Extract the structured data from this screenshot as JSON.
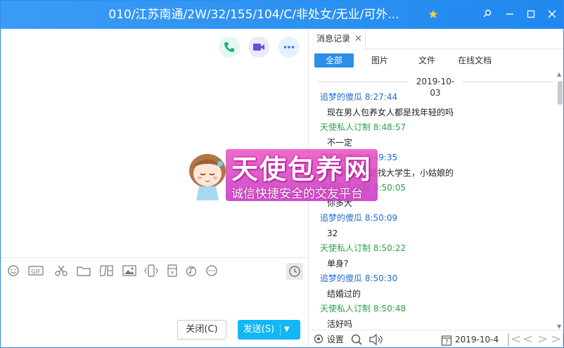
{
  "window": {
    "title": "010/江苏南通/2W/32/155/104/C/非处女/无业/可外...",
    "controls": {
      "pin": "⚲",
      "minimize": "—",
      "maximize": "☐",
      "close": "✕"
    }
  },
  "chat": {
    "actions": {
      "voice_call": "phone-icon",
      "video_call": "video-icon",
      "more": "more-icon"
    },
    "toolbar": {
      "icons": [
        "emoji-icon",
        "gif-icon",
        "scissors-icon",
        "folder-icon",
        "rich-text-icon",
        "image-icon",
        "shake-icon",
        "red-packet-icon",
        "music-icon",
        "more-icon"
      ],
      "gif_label": "GIF",
      "history_icon": "clock-icon"
    },
    "buttons": {
      "close_label": "关闭(C)",
      "send_label": "发送(S)"
    }
  },
  "ad": {
    "title": "天使包养网",
    "subtitle": "诚信快捷安全的交友平台"
  },
  "history": {
    "tab_label": "消息记录",
    "filters": [
      "全部",
      "图片",
      "文件",
      "在线文档"
    ],
    "date": "2019-10-03",
    "messages": [
      {
        "sender": "追梦的傻瓜",
        "time": "8:27:44",
        "text": "现在男人包养女人都是找年轻的吗",
        "color": "#1f6bd0"
      },
      {
        "sender": "天使私人订制",
        "time": "8:48:57",
        "text": "不一定",
        "color": "#2da14a"
      },
      {
        "sender": "追梦的傻瓜",
        "time": "8:49:35",
        "text": "我看你们都是找大学生，小姑娘的",
        "color": "#1f6bd0"
      },
      {
        "sender": "天使私人订制",
        "time": "8:50:05",
        "text": "你多大",
        "color": "#2da14a"
      },
      {
        "sender": "追梦的傻瓜",
        "time": "8:50:09",
        "text": "32",
        "color": "#1f6bd0"
      },
      {
        "sender": "天使私人订制",
        "time": "8:50:22",
        "text": "单身?",
        "color": "#2da14a"
      },
      {
        "sender": "追梦的傻瓜",
        "time": "8:50:30",
        "text": "结婚过的",
        "color": "#1f6bd0"
      },
      {
        "sender": "天使私人订制",
        "time": "8:50:48",
        "text": "活好吗",
        "color": "#2da14a"
      }
    ],
    "footer": {
      "settings_label": "设置",
      "search_icon": "search-icon",
      "sound_icon": "speaker-icon",
      "calendar_day": "7",
      "current_date": "2019-10-4"
    }
  }
}
